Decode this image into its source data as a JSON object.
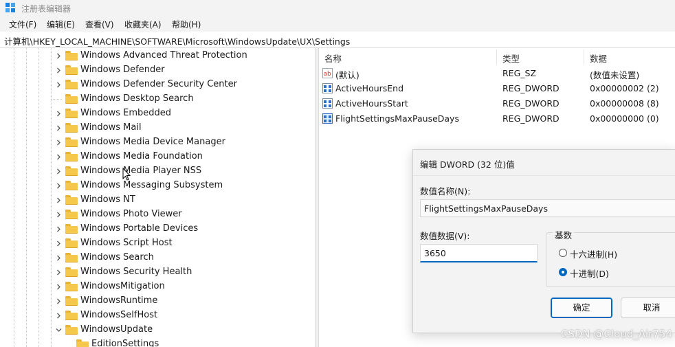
{
  "window": {
    "title": "注册表编辑器"
  },
  "menu": [
    "文件(F)",
    "编辑(E)",
    "查看(V)",
    "收藏夹(A)",
    "帮助(H)"
  ],
  "address": "计算机\\HKEY_LOCAL_MACHINE\\SOFTWARE\\Microsoft\\WindowsUpdate\\UX\\Settings",
  "tree": [
    {
      "label": "Windows Advanced Threat Protection",
      "state": "collapsed"
    },
    {
      "label": "Windows Defender",
      "state": "collapsed"
    },
    {
      "label": "Windows Defender Security Center",
      "state": "collapsed"
    },
    {
      "label": "Windows Desktop Search",
      "state": "none"
    },
    {
      "label": "Windows Embedded",
      "state": "collapsed"
    },
    {
      "label": "Windows Mail",
      "state": "collapsed"
    },
    {
      "label": "Windows Media Device Manager",
      "state": "collapsed"
    },
    {
      "label": "Windows Media Foundation",
      "state": "collapsed"
    },
    {
      "label": "Windows Media Player NSS",
      "state": "collapsed"
    },
    {
      "label": "Windows Messaging Subsystem",
      "state": "collapsed"
    },
    {
      "label": "Windows NT",
      "state": "collapsed"
    },
    {
      "label": "Windows Photo Viewer",
      "state": "collapsed"
    },
    {
      "label": "Windows Portable Devices",
      "state": "collapsed"
    },
    {
      "label": "Windows Script Host",
      "state": "collapsed"
    },
    {
      "label": "Windows Search",
      "state": "collapsed"
    },
    {
      "label": "Windows Security Health",
      "state": "collapsed"
    },
    {
      "label": "WindowsMitigation",
      "state": "collapsed"
    },
    {
      "label": "WindowsRuntime",
      "state": "collapsed"
    },
    {
      "label": "WindowsSelfHost",
      "state": "collapsed"
    },
    {
      "label": "WindowsUpdate",
      "state": "expanded"
    },
    {
      "label": "EditionSettings",
      "state": "child"
    }
  ],
  "columns": {
    "name": "名称",
    "type": "类型",
    "data": "数据"
  },
  "values": [
    {
      "icon": "string-value-icon",
      "name": "(默认)",
      "type": "REG_SZ",
      "data": "(数值未设置)"
    },
    {
      "icon": "dword-value-icon",
      "name": "ActiveHoursEnd",
      "type": "REG_DWORD",
      "data": "0x00000002 (2)"
    },
    {
      "icon": "dword-value-icon",
      "name": "ActiveHoursStart",
      "type": "REG_DWORD",
      "data": "0x00000008 (8)"
    },
    {
      "icon": "dword-value-icon",
      "name": "FlightSettingsMaxPauseDays",
      "type": "REG_DWORD",
      "data": "0x00000000 (0)"
    }
  ],
  "dialog": {
    "title": "编辑 DWORD (32 位)值",
    "name_label": "数值名称(N):",
    "name_value": "FlightSettingsMaxPauseDays",
    "data_label": "数值数据(V):",
    "data_value": "3650",
    "base_label": "基数",
    "hex_label": "十六进制(H)",
    "dec_label": "十进制(D)",
    "selected_base": "dec",
    "ok_label": "确定",
    "cancel_label": "取消"
  },
  "watermark": "CSDN @Cloud_Air754",
  "colors": {
    "accent": "#0067c0",
    "folder": "#f5c84c"
  }
}
